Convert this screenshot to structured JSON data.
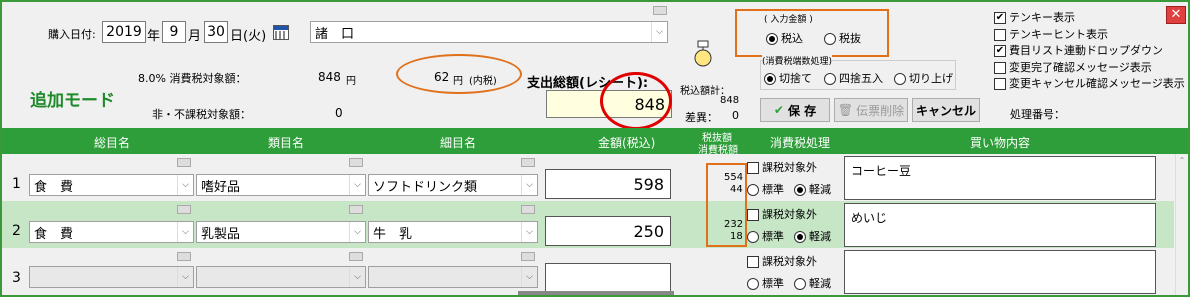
{
  "top": {
    "purchase_date_label": "購入日付:",
    "year": "2019",
    "year_unit": "年",
    "month": "9",
    "month_unit": "月",
    "day": "30",
    "day_unit": "日",
    "weekday": "(火)",
    "store_value": "諸　口",
    "mode_label": "追加モード",
    "tax8_label": "8.0% 消費税対象額：",
    "tax8_amount": "848",
    "tax8_unit": "円",
    "included_tax": "62",
    "included_tax_unit": "円",
    "included_tax_note": "(内税)",
    "nontax_label": "非・不課税対象額：",
    "nontax_amount": "0",
    "total_label": "支出総額(レシート):",
    "total_value": "848",
    "tax_total_label": "税込額計：",
    "tax_total_value": "848",
    "diff_label": "差異：",
    "diff_value": "0"
  },
  "input_amount": {
    "title": "( 入力金額 )",
    "options": [
      "税込",
      "税抜"
    ],
    "selected": "税込"
  },
  "rounding": {
    "title": "(消費税端数処理)",
    "options": [
      "切捨て",
      "四捨五入",
      "切り上げ"
    ],
    "selected": "切捨て"
  },
  "buttons": {
    "save": "保 存",
    "delete": "伝票削除",
    "cancel": "キャンセル"
  },
  "voucher_label": "処理番号：",
  "options": [
    {
      "label": "テンキー表示",
      "checked": true
    },
    {
      "label": "テンキーヒント表示",
      "checked": false
    },
    {
      "label": "費目リスト連動ドロップダウン",
      "checked": true
    },
    {
      "label": "変更完了確認メッセージ表示",
      "checked": false
    },
    {
      "label": "変更キャンセル確認メッセージ表示",
      "checked": false
    }
  ],
  "columns": {
    "category": "総目名",
    "subcategory": "類目名",
    "item": "細目名",
    "amount": "金額(税込)",
    "tax_top": "税抜額",
    "tax_bottom": "消費税額",
    "tax_handling": "消費税処理",
    "content": "買い物内容"
  },
  "rows": [
    {
      "no": "1",
      "category": "食　費",
      "subcategory": "嗜好品",
      "item": "ソフトドリンク類",
      "amount": "598",
      "pretax": "554",
      "tax": "44",
      "exempt_label": "課税対象外",
      "standard": "標準",
      "reduced": "軽減",
      "content": "コーヒー豆"
    },
    {
      "no": "2",
      "category": "食　費",
      "subcategory": "乳製品",
      "item": "牛　乳",
      "amount": "250",
      "pretax": "232",
      "tax": "18",
      "exempt_label": "課税対象外",
      "standard": "標準",
      "reduced": "軽減",
      "content": "めいじ"
    },
    {
      "no": "3",
      "category": "",
      "subcategory": "",
      "item": "",
      "amount": "",
      "pretax": "",
      "tax": "",
      "exempt_label": "課税対象外",
      "standard": "標準",
      "reduced": "軽減",
      "content": ""
    }
  ],
  "colors": {
    "header_green": "#2e9e3a",
    "highlight_row": "#c6e6c6",
    "annotation_orange": "#e0701a",
    "annotation_red": "#e00000"
  }
}
